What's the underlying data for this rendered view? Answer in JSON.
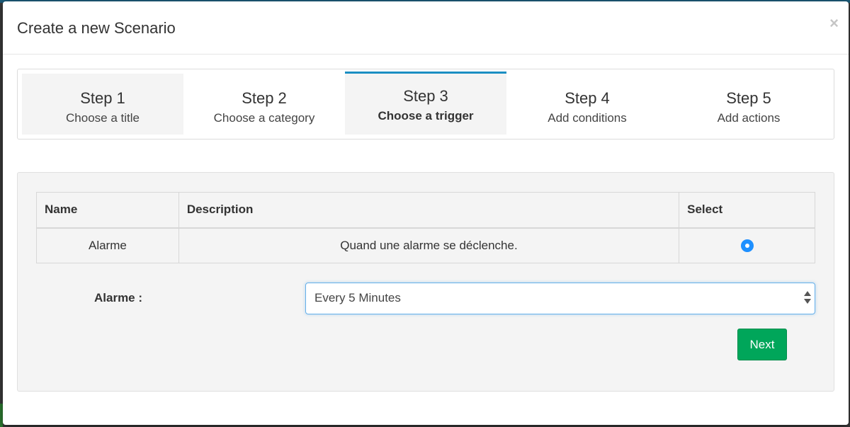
{
  "modal": {
    "title": "Create a new Scenario",
    "close_label": "×"
  },
  "steps": [
    {
      "number": "Step 1",
      "label": "Choose a title",
      "state": "completed"
    },
    {
      "number": "Step 2",
      "label": "Choose a category",
      "state": "completed"
    },
    {
      "number": "Step 3",
      "label": "Choose a trigger",
      "state": "active"
    },
    {
      "number": "Step 4",
      "label": "Add conditions",
      "state": "pending"
    },
    {
      "number": "Step 5",
      "label": "Add actions",
      "state": "pending"
    }
  ],
  "table": {
    "headers": {
      "name": "Name",
      "description": "Description",
      "select": "Select"
    },
    "rows": [
      {
        "name": "Alarme",
        "description": "Quand une alarme se déclenche.",
        "selected": true
      }
    ]
  },
  "form": {
    "label": "Alarme :",
    "select_value": "Every 5 Minutes"
  },
  "actions": {
    "next_label": "Next"
  },
  "colors": {
    "accent": "#1b8ec2",
    "radio": "#1e90ff",
    "next_button": "#00a65a"
  }
}
